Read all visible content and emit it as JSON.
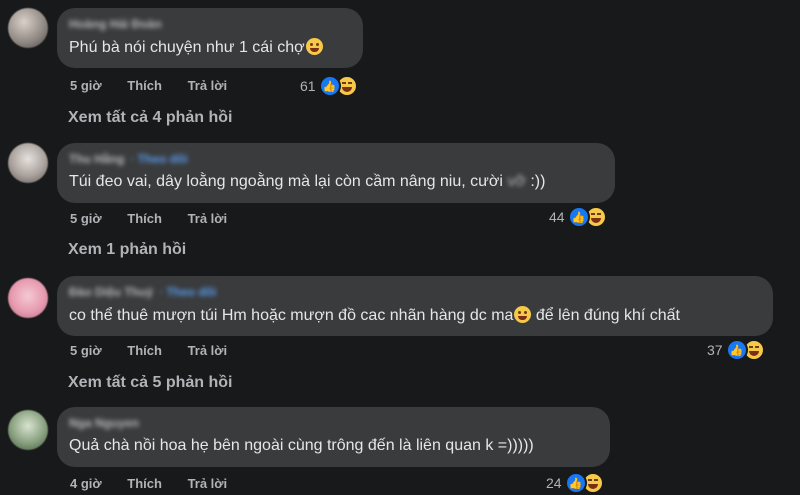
{
  "comments": [
    {
      "author": "Hoàng Hải Đoàn",
      "follow": "",
      "text": "Phú bà nói chuyện như 1 cái chợ",
      "emoji": "rofl-emoji",
      "time": "5 giờ",
      "like": "Thích",
      "reply": "Trả lời",
      "reaction_count": "61",
      "see_replies": "Xem tất cả 4 phản hồi"
    },
    {
      "author": "Thu Hằng",
      "follow": "· Theo dõi",
      "text_before": "Túi đeo vai, dây loằng ngoằng mà lại còn cầm nâng niu, cười",
      "text_blur": "vỡ",
      "text_after": ":))",
      "time": "5 giờ",
      "like": "Thích",
      "reply": "Trả lời",
      "reaction_count": "44",
      "see_replies": "Xem 1 phản hồi"
    },
    {
      "author": "Đào Diệu Thuý",
      "follow": "· Theo dõi",
      "text_before": "co thể thuê mượn túi Hm hoặc mượn đồ cac nhãn hàng dc ma",
      "text_after": "để lên đúng khí chất",
      "emoji": "tears-of-joy-emoji",
      "time": "5 giờ",
      "like": "Thích",
      "reply": "Trả lời",
      "reaction_count": "37",
      "see_replies": "Xem tất cả 5 phản hồi"
    },
    {
      "author": "Nga Nguyen",
      "follow": "",
      "text": "Quả chà nồi hoa hẹ bên ngoài cùng trông đến là liên quan k =)))))",
      "time": "4 giờ",
      "like": "Thích",
      "reply": "Trả lời",
      "reaction_count": "24"
    }
  ],
  "colors": {
    "background": "#18191a",
    "bubble": "#3a3b3c",
    "like_blue": "#1877f2",
    "follow_blue": "#5aa0f5"
  }
}
